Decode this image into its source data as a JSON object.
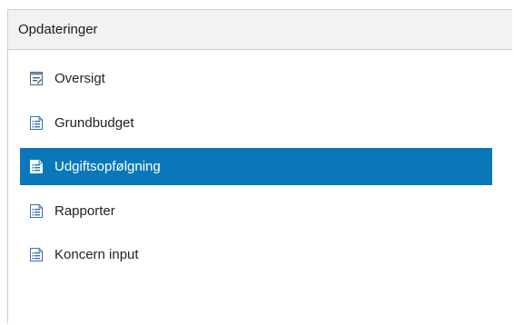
{
  "panel": {
    "title": "Opdateringer"
  },
  "menu": {
    "items": [
      {
        "label": "Oversigt",
        "icon": "edit-form-icon",
        "active": false
      },
      {
        "label": "Grundbudget",
        "icon": "document-list-icon",
        "active": false
      },
      {
        "label": "Udgiftsopfølgning",
        "icon": "document-list-icon",
        "active": true
      },
      {
        "label": "Rapporter",
        "icon": "document-list-icon",
        "active": false
      },
      {
        "label": "Koncern input",
        "icon": "document-list-icon",
        "active": false
      }
    ]
  },
  "colors": {
    "active_bg": "#0a78b8",
    "header_bg": "#f2f2f2",
    "icon_blue": "#3a6fb0"
  }
}
